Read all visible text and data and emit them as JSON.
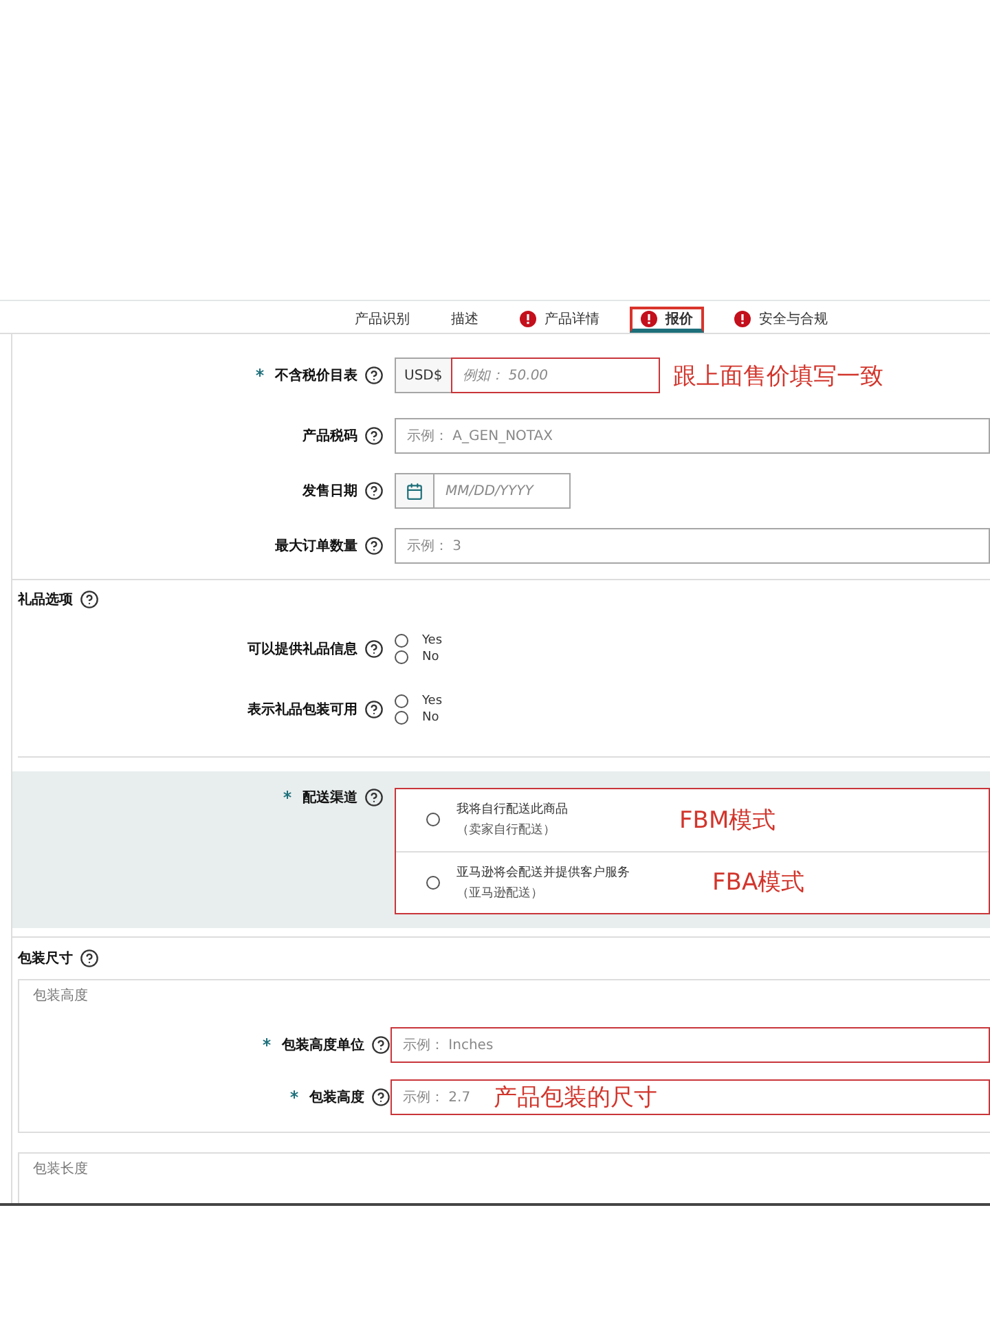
{
  "tabs": [
    {
      "label": "产品识别",
      "selected": false,
      "error": false
    },
    {
      "label": "描述",
      "selected": false,
      "error": false
    },
    {
      "label": "产品详情",
      "selected": false,
      "error": true
    },
    {
      "label": "报价",
      "selected": true,
      "error": true
    },
    {
      "label": "安全与合规",
      "selected": false,
      "error": true
    }
  ],
  "pricing_fields": [
    {
      "label": "不含税价目表",
      "required": true,
      "kind": "currency",
      "prefix": "USD$",
      "placeholder": "例如： 50.00",
      "invalid": true,
      "annotation": "跟上面售价填写一致"
    },
    {
      "label": "产品税码",
      "required": false,
      "kind": "text",
      "placeholder": "示例： A_GEN_NOTAX",
      "invalid": false
    },
    {
      "label": "发售日期",
      "required": false,
      "kind": "date",
      "placeholder": "MM/DD/YYYY",
      "invalid": false
    },
    {
      "label": "最大订单数量",
      "required": false,
      "kind": "text",
      "placeholder": "示例： 3",
      "invalid": false
    }
  ],
  "gift_options": {
    "title": "礼品选项",
    "questions": [
      {
        "label": "可以提供礼品信息",
        "options": [
          {
            "label": "Yes",
            "selected": false
          },
          {
            "label": "No",
            "selected": false
          }
        ]
      },
      {
        "label": "表示礼品包装可用",
        "options": [
          {
            "label": "Yes",
            "selected": false
          },
          {
            "label": "No",
            "selected": false
          }
        ]
      }
    ]
  },
  "fulfillment": {
    "label": "配送渠道",
    "required": true,
    "invalid": true,
    "options": [
      {
        "label": "我将自行配送此商品",
        "note": "（卖家自行配送）",
        "selected": false,
        "annotation": "FBM模式"
      },
      {
        "label": "亚马逊将会配送并提供客户服务",
        "note": "（亚马逊配送）",
        "selected": false,
        "annotation": "FBA模式"
      }
    ]
  },
  "package_dimensions": {
    "title": "包装尺寸",
    "groups": [
      {
        "legend": "包装高度",
        "fields": [
          {
            "label": "包装高度单位",
            "required": true,
            "placeholder": "示例： Inches",
            "invalid": true
          },
          {
            "label": "包装高度",
            "required": true,
            "placeholder": "示例： 2.7",
            "invalid": true,
            "annotation": "产品包装的尺寸"
          }
        ]
      },
      {
        "legend": "包装长度"
      }
    ]
  }
}
